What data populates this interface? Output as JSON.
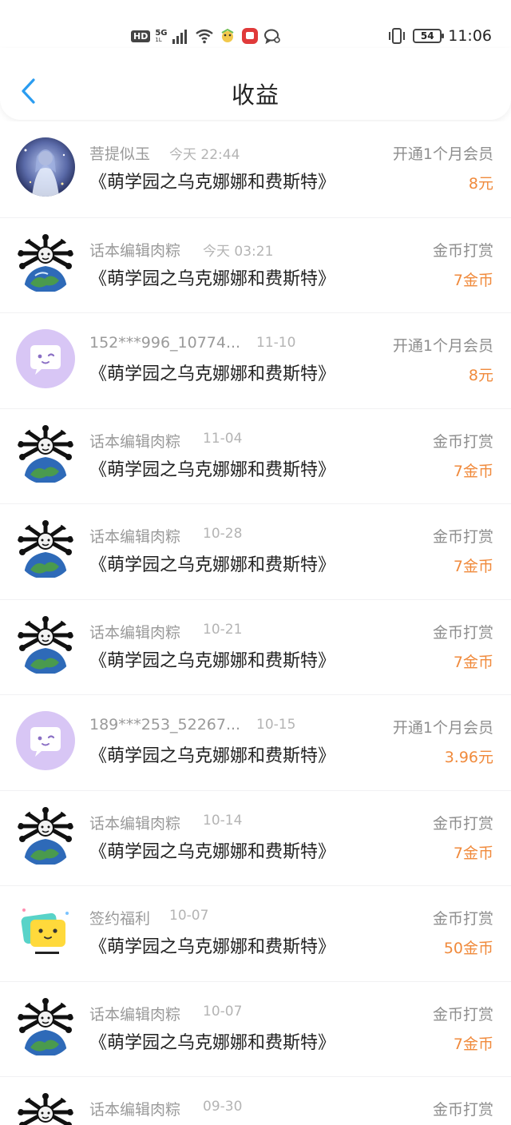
{
  "status_bar": {
    "hd": "HD",
    "network_top": "5G",
    "network_bottom": "1L",
    "battery": "54",
    "time": "11:06"
  },
  "header": {
    "title": "收益"
  },
  "records": [
    {
      "name": "菩提似玉",
      "date": "今天 22:44",
      "book": "《萌学园之乌克娜娜和费斯特》",
      "type": "开通1个月会员",
      "amount": "8元",
      "avatar": "anime-avatar"
    },
    {
      "name": "话本编辑肉粽",
      "date": "今天 03:21",
      "book": "《萌学园之乌克娜娜和费斯特》",
      "type": "金币打赏",
      "amount": "7金币",
      "avatar": "earth-avatar"
    },
    {
      "name": "152***996_10774...",
      "date": "11-10",
      "book": "《萌学园之乌克娜娜和费斯特》",
      "type": "开通1个月会员",
      "amount": "8元",
      "avatar": "chat-bubble-avatar"
    },
    {
      "name": "话本编辑肉粽",
      "date": "11-04",
      "book": "《萌学园之乌克娜娜和费斯特》",
      "type": "金币打赏",
      "amount": "7金币",
      "avatar": "earth-avatar"
    },
    {
      "name": "话本编辑肉粽",
      "date": "10-28",
      "book": "《萌学园之乌克娜娜和费斯特》",
      "type": "金币打赏",
      "amount": "7金币",
      "avatar": "earth-avatar"
    },
    {
      "name": "话本编辑肉粽",
      "date": "10-21",
      "book": "《萌学园之乌克娜娜和费斯特》",
      "type": "金币打赏",
      "amount": "7金币",
      "avatar": "earth-avatar"
    },
    {
      "name": "189***253_52267...",
      "date": "10-15",
      "book": "《萌学园之乌克娜娜和费斯特》",
      "type": "开通1个月会员",
      "amount": "3.96元",
      "avatar": "chat-bubble-avatar"
    },
    {
      "name": "话本编辑肉粽",
      "date": "10-14",
      "book": "《萌学园之乌克娜娜和费斯特》",
      "type": "金币打赏",
      "amount": "7金币",
      "avatar": "earth-avatar"
    },
    {
      "name": "签约福利",
      "date": "10-07",
      "book": "《萌学园之乌克娜娜和费斯特》",
      "type": "金币打赏",
      "amount": "50金币",
      "avatar": "yellow-chat-avatar"
    },
    {
      "name": "话本编辑肉粽",
      "date": "10-07",
      "book": "《萌学园之乌克娜娜和费斯特》",
      "type": "金币打赏",
      "amount": "7金币",
      "avatar": "earth-avatar"
    },
    {
      "name": "话本编辑肉粽",
      "date": "09-30",
      "book": "",
      "type": "金币打赏",
      "amount": "",
      "avatar": "earth-avatar"
    }
  ],
  "colors": {
    "amount": "#f08a3c",
    "back_arrow": "#2a9cf0",
    "chat_avatar_bg": "#d8c6f5"
  }
}
